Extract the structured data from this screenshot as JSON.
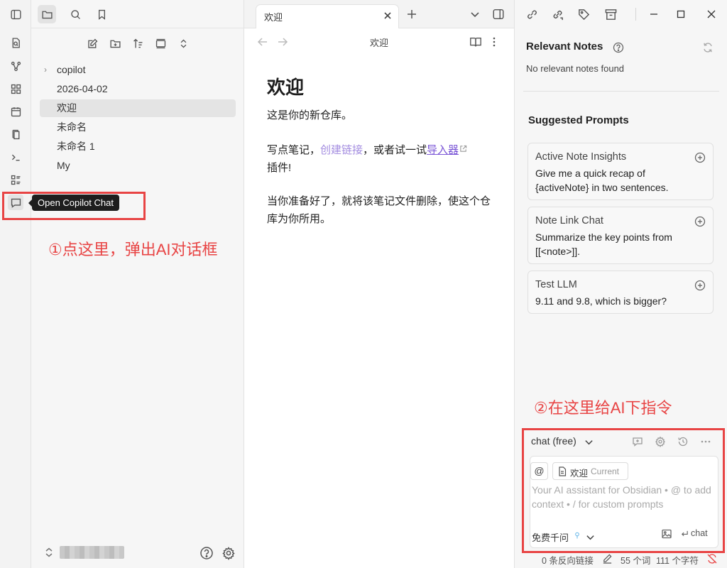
{
  "sidebar": {
    "files": [
      {
        "label": "copilot",
        "folder": true
      },
      {
        "label": "2026-04-02"
      },
      {
        "label": "欢迎",
        "active": true
      },
      {
        "label": "未命名"
      },
      {
        "label": "未命名 1"
      },
      {
        "label": "My"
      }
    ]
  },
  "tooltip": "Open Copilot Chat",
  "annotations": {
    "first": "①点这里，弹出AI对话框",
    "second": "②在这里给AI下指令"
  },
  "tab": {
    "title": "欢迎"
  },
  "view_header": {
    "title": "欢迎"
  },
  "note": {
    "title": "欢迎",
    "line1": "这是你的新仓库。",
    "p2_before": "写点笔记，",
    "p2_link": "创建链接",
    "p2_mid": "，或者试一试",
    "p2_ext_link": "导入器",
    "p2_after": "插件!",
    "p3": "当你准备好了，就将该笔记文件删除，使这个仓库为你所用。"
  },
  "right": {
    "relevant_title": "Relevant Notes",
    "relevant_empty": "No relevant notes found",
    "suggested_title": "Suggested Prompts",
    "prompts": [
      {
        "title": "Active Note Insights",
        "text": "Give me a quick recap of {activeNote} in two sentences."
      },
      {
        "title": "Note Link Chat",
        "text": "Summarize the key points from [[<note>]]."
      },
      {
        "title": "Test LLM",
        "text": "9.11 and 9.8, which is bigger?"
      }
    ],
    "chat_mode": "chat (free)",
    "at_symbol": "@",
    "context_chip": "欢迎",
    "context_chip_tag": "Current",
    "input_placeholder": "Your AI assistant for Obsidian • @ to add context • / for custom prompts",
    "model": "免费千问",
    "send_label": "chat"
  },
  "status": {
    "backlinks": "0 条反向链接",
    "words": "55 个词",
    "chars": "111 个字符"
  },
  "colors": {
    "accent": "#7a55d6",
    "annotation": "#e84444"
  }
}
